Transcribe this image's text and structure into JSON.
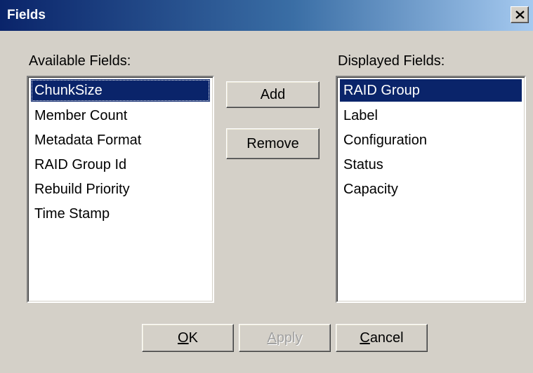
{
  "window": {
    "title": "Fields"
  },
  "available": {
    "label": "Available Fields:",
    "items": [
      "ChunkSize",
      "Member Count",
      "Metadata Format",
      "RAID Group Id",
      "Rebuild Priority",
      "Time Stamp"
    ],
    "selected": "ChunkSize"
  },
  "displayed": {
    "label": "Displayed Fields:",
    "items": [
      "RAID Group",
      "Label",
      "Configuration",
      "Status",
      "Capacity"
    ],
    "selected": "RAID Group"
  },
  "actions": {
    "add": "Add",
    "remove": "Remove"
  },
  "footer": {
    "ok": {
      "mnemonic": "O",
      "rest": "K"
    },
    "apply": {
      "mnemonic": "A",
      "rest": "pply",
      "disabled": true
    },
    "cancel": {
      "mnemonic": "C",
      "rest": "ancel"
    }
  },
  "colors": {
    "selection": "#0a246a",
    "face": "#d4d0c8",
    "title_start": "#0a246a",
    "title_end": "#a6caf0"
  },
  "icons": {
    "close": "close-icon"
  }
}
